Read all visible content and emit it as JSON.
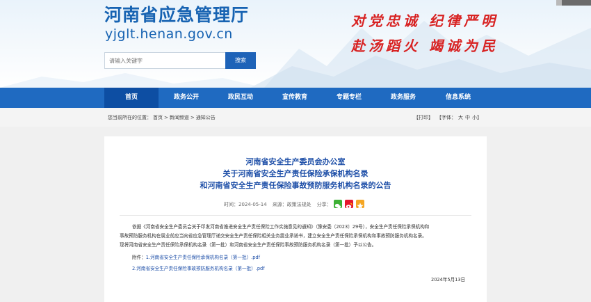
{
  "header": {
    "site_title": "河南省应急管理厅",
    "site_domain": "yjglt.henan.gov.cn",
    "slogan_line1": "对党忠诚 纪律严明",
    "slogan_line2": "赴汤蹈火 竭诚为民",
    "search_placeholder": "请输入关键字",
    "search_button": "搜索"
  },
  "nav": {
    "items": [
      "首页",
      "政务公开",
      "政民互动",
      "宣传教育",
      "专题专栏",
      "政务服务",
      "信息系统"
    ],
    "active_index": 0
  },
  "breadcrumb": {
    "prefix": "您当前所在的位置：",
    "items": [
      "首页",
      "新闻频道",
      "通知公告"
    ],
    "separator": ">"
  },
  "tools": {
    "print": "【打印】",
    "font_label": "【字体：",
    "sizes": [
      "大",
      "中",
      "小"
    ],
    "close": "】"
  },
  "article": {
    "title_lines": [
      "河南省安全生产委员会办公室",
      "关于河南省安全生产责任保险承保机构名录",
      "和河南省安全生产责任保险事故预防服务机构名录的公告"
    ],
    "time_label": "时间：2024-05-14",
    "source_label": "来源：政策法规处",
    "share_label": "分享：",
    "paragraph_lines": [
      "依据《河南省安全生产委员会关于印发河南省推进安全生产责任保险工作实施意见的通知》（豫安委〔2023〕29号），安全生产责任保险承保机构和",
      "事故预防服务机构在属业前应当向省应急管理厅递交安全生产责任保险相关业务震业承诺书，建立安全生产责任保险承保机构和事故预防服务机构名录。",
      "现将河南省安全生产责任保险承保机构名录（第一批）和河南省安全生产责任保险事故预防服务机构名录（第一批）予以公告。"
    ],
    "attachment_label": "附件：",
    "attachment_1": "1.河南省安全生产责任保险承保机构名录（第一批）.pdf",
    "attachment_2": "2.河南省安全生产责任保险事故预防服务机构名录（第一批）.pdf",
    "date": "2024年5月13日"
  },
  "colors": {
    "brand_blue": "#1f6ac1",
    "nav_active": "#0d4ea3",
    "slogan_red": "#d82222",
    "title_blue": "#1e4fa8"
  }
}
